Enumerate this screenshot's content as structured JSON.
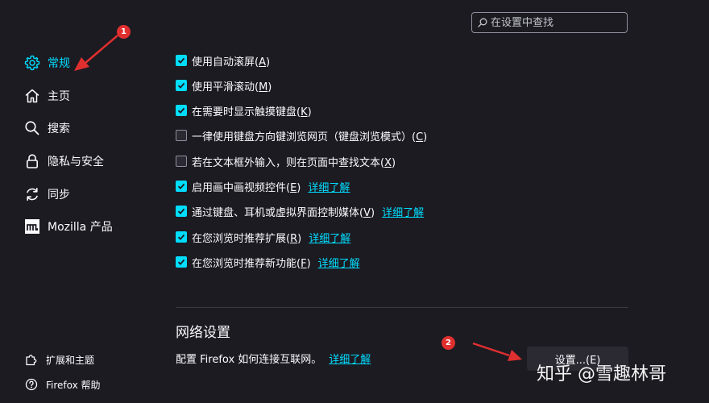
{
  "search": {
    "placeholder": "在设置中查找"
  },
  "sidebar": {
    "items": [
      {
        "label": "常规",
        "icon": "gear-icon",
        "active": true
      },
      {
        "label": "主页",
        "icon": "home-icon"
      },
      {
        "label": "搜索",
        "icon": "search-icon"
      },
      {
        "label": "隐私与安全",
        "icon": "lock-icon"
      },
      {
        "label": "同步",
        "icon": "sync-icon"
      },
      {
        "label": "Mozilla 产品",
        "icon": "mozilla-icon"
      }
    ],
    "footer": [
      {
        "label": "扩展和主题",
        "icon": "puzzle-icon"
      },
      {
        "label": "Firefox 帮助",
        "icon": "help-icon"
      }
    ]
  },
  "browsing": {
    "options": [
      {
        "text": "使用自动滚屏(",
        "key": "A",
        "tail": ")",
        "checked": true
      },
      {
        "text": "使用平滑滚动(",
        "key": "M",
        "tail": ")",
        "checked": true
      },
      {
        "text": "在需要时显示触摸键盘(",
        "key": "K",
        "tail": ")",
        "checked": true
      },
      {
        "text": "一律使用键盘方向键浏览网页（键盘浏览模式）(",
        "key": "C",
        "tail": ")",
        "checked": false
      },
      {
        "text": "若在文本框外输入，则在页面中查找文本(",
        "key": "X",
        "tail": ")",
        "checked": false
      },
      {
        "text": "启用画中画视频控件(",
        "key": "E",
        "tail": ")",
        "checked": true,
        "link": "详细了解"
      },
      {
        "text": "通过键盘、耳机或虚拟界面控制媒体(",
        "key": "V",
        "tail": ")",
        "checked": true,
        "link": "详细了解"
      },
      {
        "text": "在您浏览时推荐扩展(",
        "key": "R",
        "tail": ")",
        "checked": true,
        "link": "详细了解"
      },
      {
        "text": "在您浏览时推荐新功能(",
        "key": "F",
        "tail": ")",
        "checked": true,
        "link": "详细了解"
      }
    ]
  },
  "network": {
    "title": "网络设置",
    "description": "配置 Firefox 如何连接互联网。",
    "link": "详细了解",
    "button": "设置...(E)"
  },
  "annotations": {
    "badge1": "1",
    "badge2": "2"
  },
  "watermark": "知乎 @雪趣林哥",
  "colors": {
    "background": "#1c1b22",
    "accent": "#00ddff",
    "annotation": "#e02f2f",
    "button": "#2b2a33"
  }
}
